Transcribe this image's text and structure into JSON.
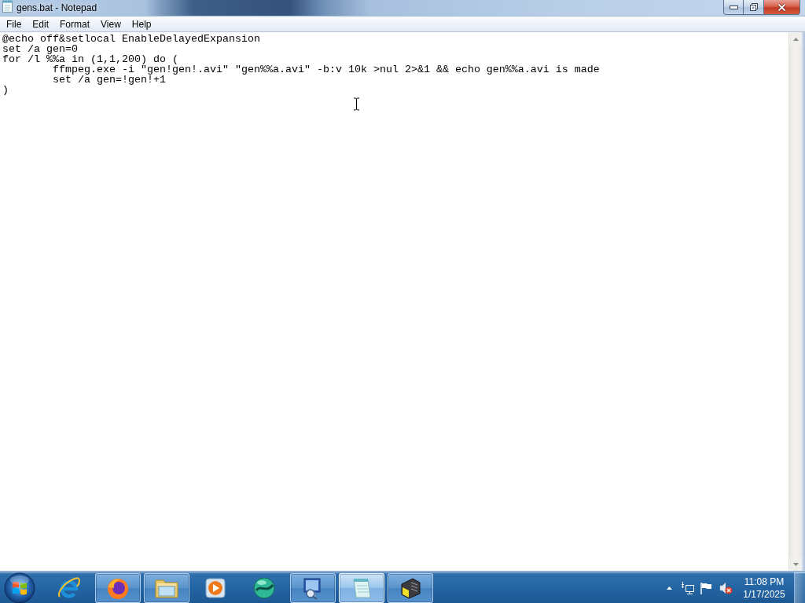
{
  "window": {
    "title": "gens.bat - Notepad"
  },
  "menu_bar": [
    "File",
    "Edit",
    "Format",
    "View",
    "Help"
  ],
  "editor": {
    "lines": [
      "@echo off&setlocal EnableDelayedExpansion",
      "set /a gen=0",
      "for /l %%a in (1,1,200) do (",
      "\tffmpeg.exe -i \"gen!gen!.avi\" \"gen%%a.avi\" -b:v 10k >nul 2>&1 && echo gen%%a.avi is made",
      "\tset /a gen=!gen!+1",
      ")"
    ]
  },
  "taskbar": {
    "apps": [
      {
        "kind": "e-browser",
        "running": false,
        "selected": false
      },
      {
        "kind": "fox-browser",
        "running": true,
        "selected": false
      },
      {
        "kind": "folder",
        "running": true,
        "selected": false
      },
      {
        "kind": "media",
        "running": false,
        "selected": false
      },
      {
        "kind": "globe",
        "running": false,
        "selected": false
      },
      {
        "kind": "monitor",
        "running": true,
        "selected": false
      },
      {
        "kind": "notepad",
        "running": true,
        "selected": true
      },
      {
        "kind": "gadget",
        "running": true,
        "selected": false
      }
    ],
    "tray": {
      "volume_muted": true
    },
    "clock": {
      "time": "11:08 PM",
      "date": "1/17/2025"
    }
  }
}
